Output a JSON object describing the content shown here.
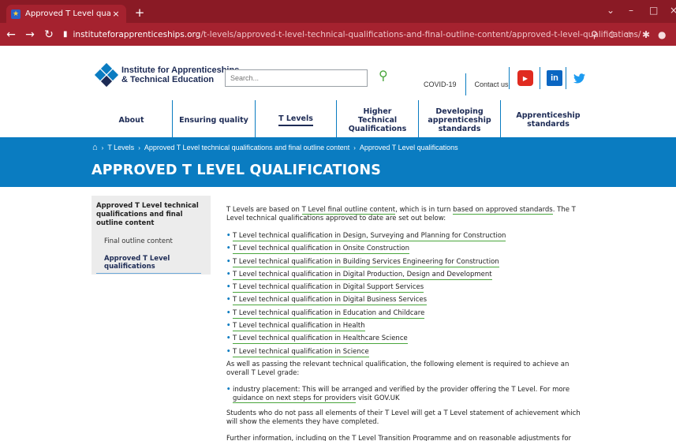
{
  "browser": {
    "tab_title": "Approved T Level qualifications | Ins",
    "tab_close": "×",
    "new_tab": "+",
    "url_domain": "instituteforapprenticeships.org",
    "url_path": "/t-levels/approved-t-level-technical-qualifications-and-final-outline-content/approved-t-level-qualifications/"
  },
  "header": {
    "logo_line1": "Institute for Apprenticeships",
    "logo_line2": "& Technical Education",
    "search_placeholder": "Search...",
    "covid_link": "COVID-19",
    "contact_link": "Contact us",
    "linkedin": "in",
    "youtube": "▶"
  },
  "nav": {
    "items": [
      {
        "label": "About"
      },
      {
        "label": "Ensuring quality"
      },
      {
        "label": "T Levels"
      },
      {
        "label": "Higher Technical Qualifications"
      },
      {
        "label": "Developing apprenticeship standards"
      },
      {
        "label": "Apprenticeship standards"
      }
    ]
  },
  "breadcrumb": {
    "items": [
      "T Levels",
      "Approved T Level technical qualifications and final outline content",
      "Approved T Level qualifications"
    ]
  },
  "page_title": "APPROVED T LEVEL QUALIFICATIONS",
  "sidebar": {
    "heading": "Approved T Level technical qualifications and final outline content",
    "links": [
      "Final outline content",
      "Approved T Level qualifications"
    ]
  },
  "content": {
    "intro_1": "T Levels are based on ",
    "intro_link_1": "T Level final outline content",
    "intro_2": ", which is in turn ",
    "intro_link_2": "based on approved standards",
    "intro_3": ". The T Level technical qualifications approved to date are set out below:",
    "qualifications": [
      "T Level technical qualification in Design, Surveying and Planning for Construction",
      "T Level technical qualification in Onsite Construction",
      "T Level technical qualification in Building Services Engineering for Construction",
      "T Level technical qualification in Digital Production, Design and Development",
      "T Level technical qualification in Digital Support Services",
      "T Level technical qualification in Digital Business Services",
      "T Level technical qualification in Education and Childcare",
      "T Level technical qualification in Health",
      "T Level technical qualification in Healthcare Science",
      "T Level technical qualification in Science"
    ],
    "para_2": "As well as passing the relevant technical qualification, the following element is required to achieve an overall T Level grade:",
    "placement_1": "industry placement: This will be arranged and verified by the provider offering the T Level. For more ",
    "placement_link": "guidance on next steps for providers",
    "placement_2": " visit GOV.UK",
    "para_3": "Students who do not pass all elements of their T Level will get a T Level statement of achievement which will show the elements they have completed.",
    "para_4_1": "Further information, including on the ",
    "para_4_link1": "T Level Transition Programme",
    "para_4_2": " and on ",
    "para_4_link2": "reasonable adjustments for students with special educational needs and disabilities visit GOV.UK"
  }
}
